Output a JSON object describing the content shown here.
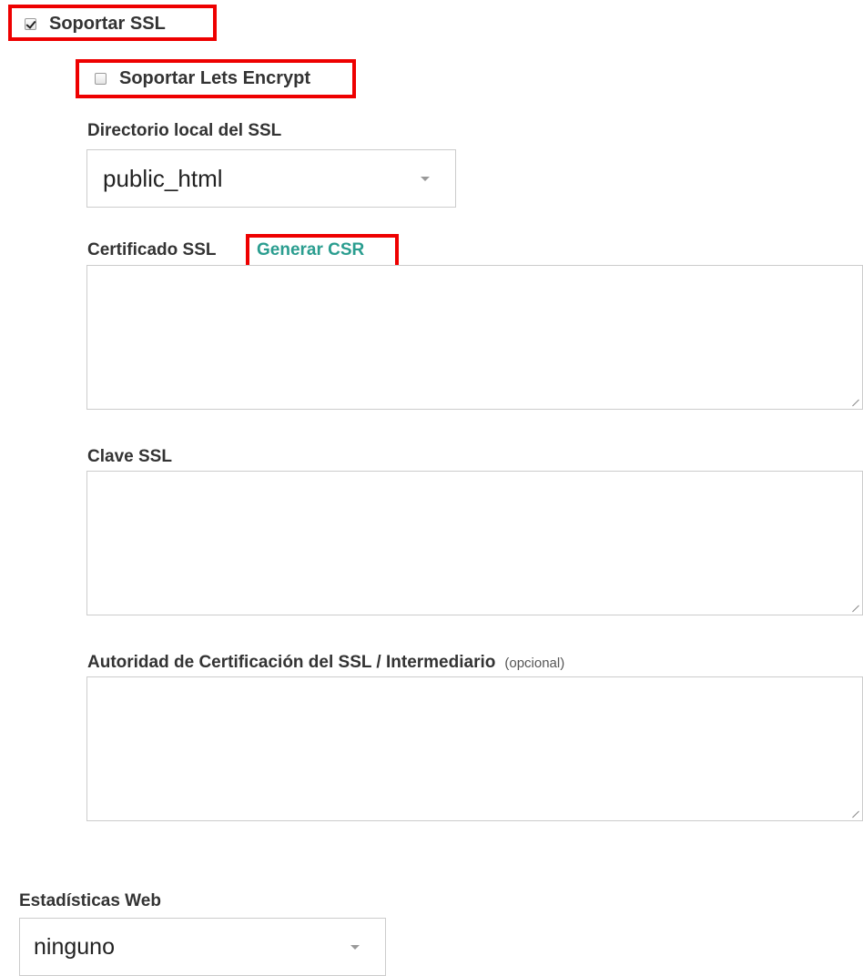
{
  "ssl": {
    "support_ssl": {
      "label": "Soportar SSL",
      "checked": true
    },
    "support_lets_encrypt": {
      "label": "Soportar Lets Encrypt",
      "checked": false
    },
    "local_dir": {
      "label": "Directorio local del SSL",
      "value": "public_html"
    },
    "certificate": {
      "label": "Certificado SSL",
      "generate_csr_link": "Generar CSR",
      "value": ""
    },
    "key": {
      "label": "Clave SSL",
      "value": ""
    },
    "ca": {
      "label": "Autoridad de Certificación del SSL / Intermediario",
      "optional_note": "(opcional)",
      "value": ""
    }
  },
  "web_stats": {
    "label": "Estadísticas Web",
    "value": "ninguno"
  },
  "colors": {
    "highlight": "#ee0000",
    "link": "#2a9d8f",
    "text": "#333333",
    "border": "#cccccc"
  }
}
